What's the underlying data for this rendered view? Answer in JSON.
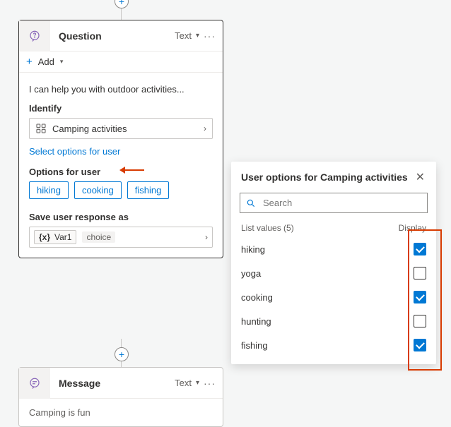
{
  "card_question": {
    "title": "Question",
    "text_type": "Text",
    "add_label": "Add",
    "prompt": "I can help you with outdoor activities...",
    "identify_label": "Identify",
    "identify_value": "Camping activities",
    "select_link": "Select options for user",
    "options_label": "Options for user",
    "options": [
      "hiking",
      "cooking",
      "fishing"
    ],
    "save_label": "Save user response as",
    "variable_name": "Var1",
    "variable_type": "choice"
  },
  "card_message": {
    "title": "Message",
    "text_type": "Text",
    "body": "Camping is fun"
  },
  "flyout": {
    "title": "User options for Camping activities",
    "search_placeholder": "Search",
    "list_header": "List values (5)",
    "display_header": "Display",
    "items": [
      {
        "label": "hiking",
        "checked": true
      },
      {
        "label": "yoga",
        "checked": false
      },
      {
        "label": "cooking",
        "checked": true
      },
      {
        "label": "hunting",
        "checked": false
      },
      {
        "label": "fishing",
        "checked": true
      }
    ]
  }
}
